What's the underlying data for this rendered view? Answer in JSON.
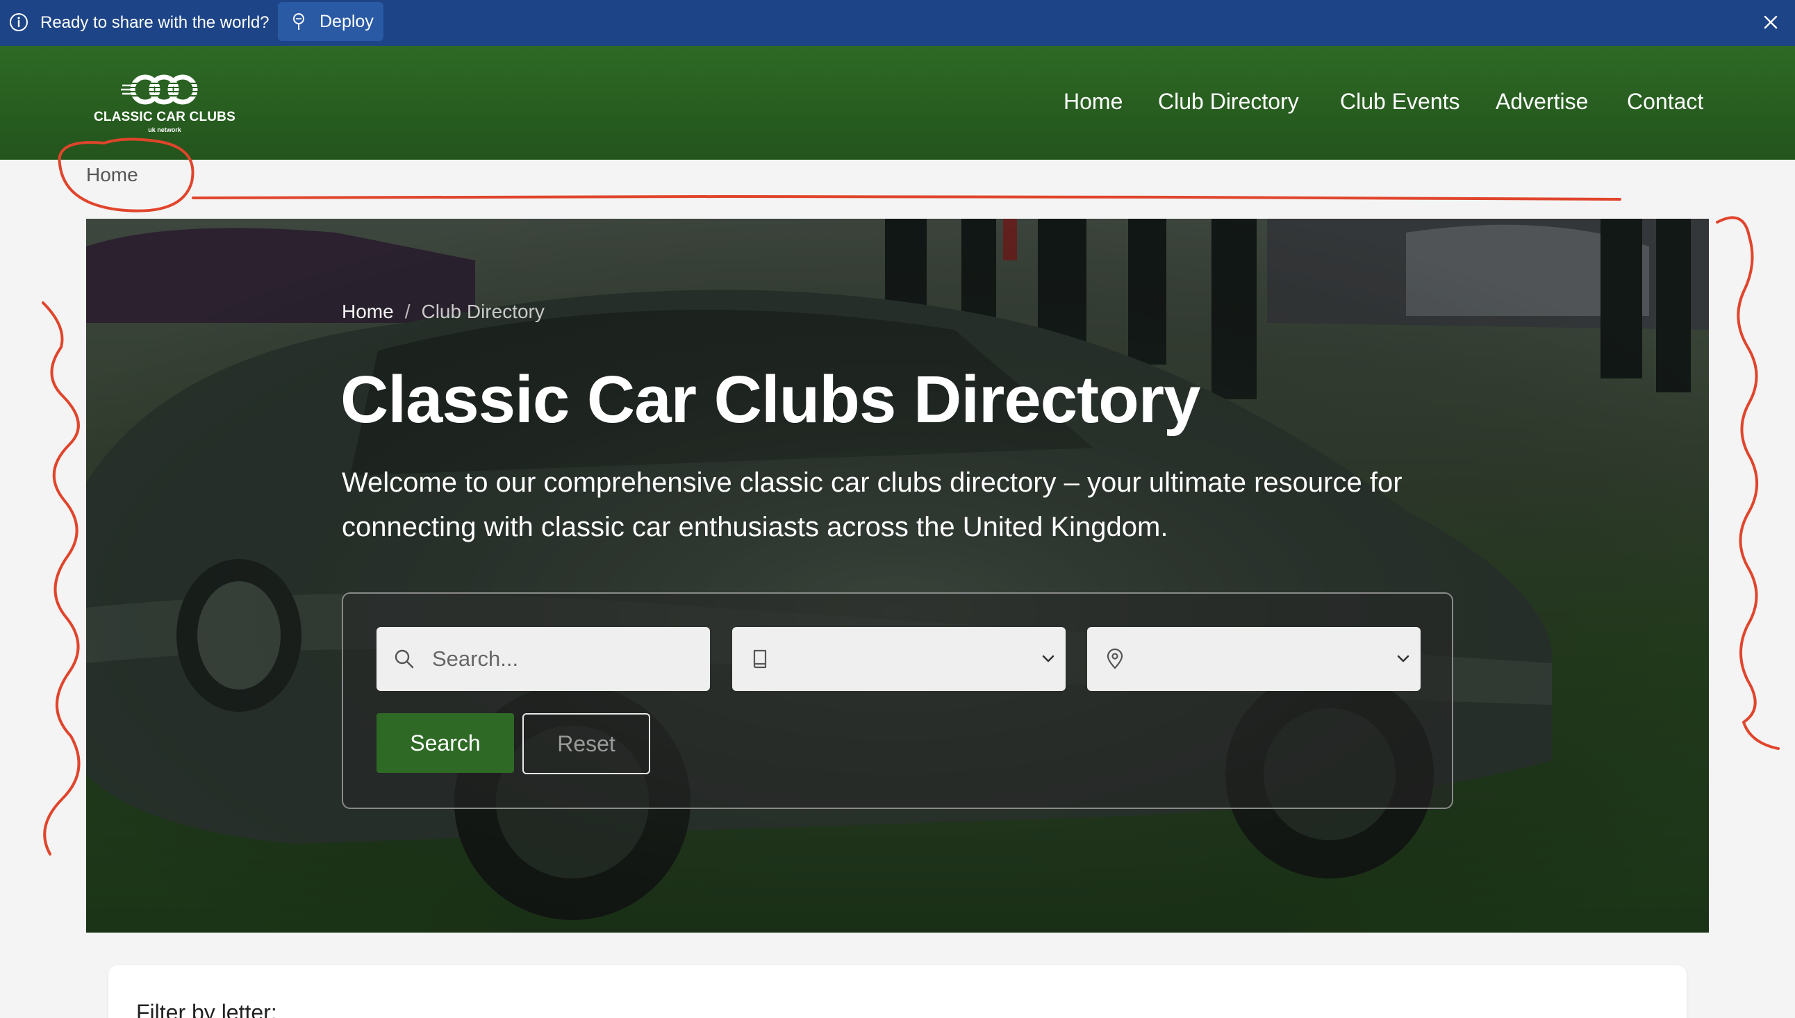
{
  "banner": {
    "message": "Ready to share with the world?",
    "deploy_label": "Deploy",
    "info_icon": "info-icon",
    "deploy_icon": "pin-icon",
    "close_icon": "close-icon",
    "background": "#1d4486"
  },
  "header": {
    "logo_title": "CLASSIC CAR CLUBS",
    "logo_subtitle": "uk network",
    "background": "#2e6a25",
    "nav": [
      {
        "label": "Home"
      },
      {
        "label": "Club Directory"
      },
      {
        "label": "Club Events"
      },
      {
        "label": "Advertise"
      },
      {
        "label": "Contact"
      }
    ]
  },
  "breadcrumb_top": {
    "label": "Home"
  },
  "hero": {
    "breadcrumb": {
      "home": "Home",
      "separator": "/",
      "current": "Club Directory"
    },
    "title": "Classic Car Clubs Directory",
    "intro": "Welcome to our comprehensive classic car clubs directory – your ultimate resource for connecting with classic car enthusiasts across the United Kingdom."
  },
  "search": {
    "placeholder": "Search...",
    "category_value": "",
    "location_value": "",
    "search_icon": "search-icon",
    "category_icon": "book-icon",
    "location_icon": "map-pin-icon",
    "search_button": "Search",
    "reset_button": "Reset",
    "accent": "#2e6a25"
  },
  "filter": {
    "title": "Filter by letter:"
  },
  "annotation_color": "#e0452c"
}
